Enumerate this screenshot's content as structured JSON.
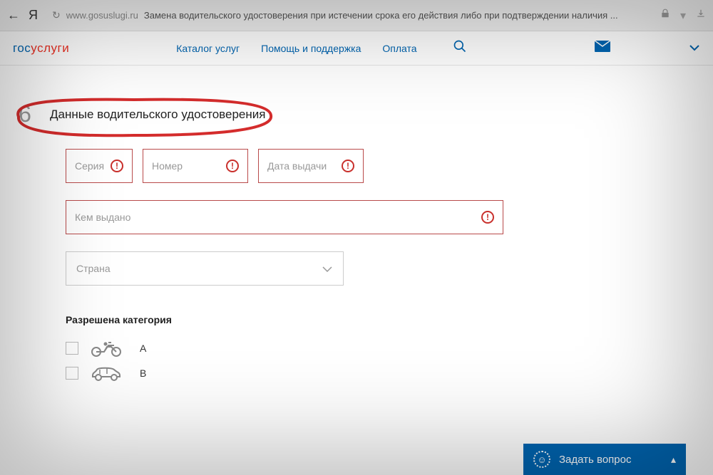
{
  "browser": {
    "domain": "www.gosuslugi.ru",
    "page_title": "Замена водительского удостоверения при истечении срока его действия либо при подтверждении наличия ..."
  },
  "logo": {
    "part1": "гос",
    "part2": "услуги"
  },
  "nav": {
    "catalog": "Каталог услуг",
    "help": "Помощь и поддержка",
    "payment": "Оплата"
  },
  "step": {
    "number": "6",
    "title": "Данные водительского удостоверения"
  },
  "fields": {
    "series": "Серия",
    "number": "Номер",
    "issue_date": "Дата выдачи",
    "issued_by": "Кем выдано",
    "country": "Страна"
  },
  "categories": {
    "title": "Разрешена категория",
    "items": [
      {
        "label": "A"
      },
      {
        "label": "B"
      }
    ]
  },
  "ask_button": "Задать вопрос"
}
